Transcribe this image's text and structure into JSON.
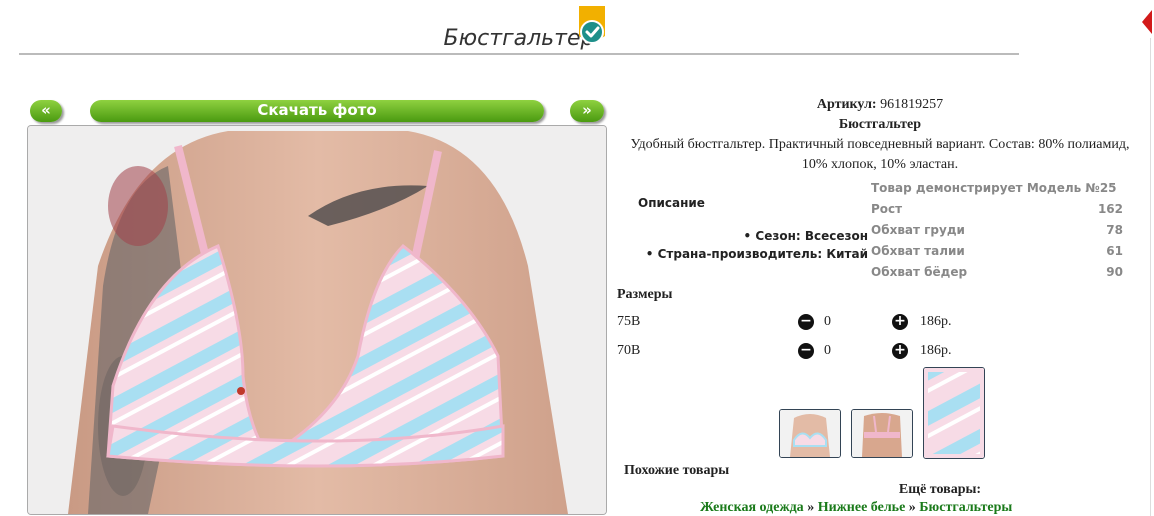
{
  "header": {
    "title": "Бюстгальтер"
  },
  "gallery": {
    "prev_label": "«",
    "download_label": "Скачать фото",
    "next_label": "»"
  },
  "product": {
    "article_label": "Артикул:",
    "article_value": "961819257",
    "name": "Бюстгальтер",
    "description": "Удобный бюстгальтер. Практичный повседневный вариант. Состав: 80% полиамид, 10% хлопок, 10% эластан.",
    "details_title": "Описание",
    "bullets": [
      "Сезон: Всесезон",
      "Страна-производитель: Китай"
    ]
  },
  "model": {
    "heading": "Товар демонстрирует Модель №25",
    "rows": [
      {
        "label": "Рост",
        "value": "162"
      },
      {
        "label": "Обхват груди",
        "value": "78"
      },
      {
        "label": "Обхват талии",
        "value": "61"
      },
      {
        "label": "Обхват бёдер",
        "value": "90"
      }
    ]
  },
  "sizes": {
    "title": "Размеры",
    "rows": [
      {
        "size": "75B",
        "qty": "0",
        "price": "186р."
      },
      {
        "size": "70B",
        "qty": "0",
        "price": "186р."
      }
    ]
  },
  "footer": {
    "similar_label": "Похожие товары",
    "more_label": "Ещё товары:",
    "crumbs": [
      "Женская одежда",
      "Нижнее белье",
      "Бюстгальтеры"
    ],
    "separator": "»"
  },
  "colors": {
    "accent_green": "#5aab18",
    "link_green": "#1a7a1a",
    "badge_gold": "#f2b000",
    "badge_teal": "#1d8f8a"
  }
}
